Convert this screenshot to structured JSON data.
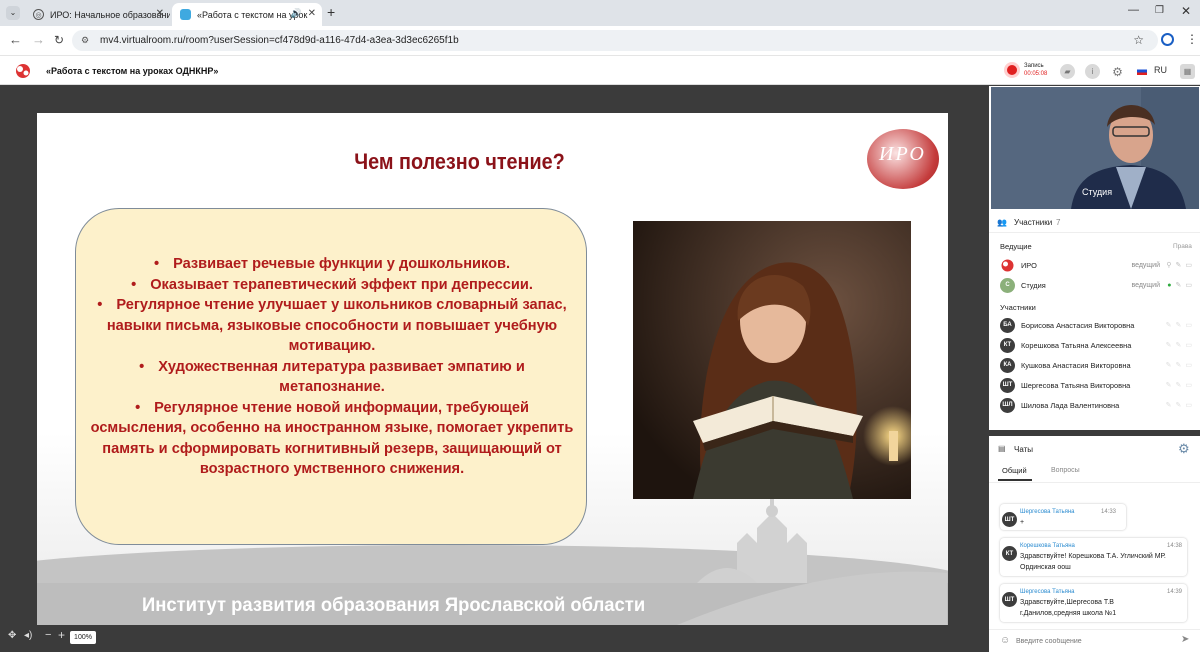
{
  "browser": {
    "tabs": [
      {
        "title": "ИРО: Начальное образование",
        "active": false
      },
      {
        "title": "«Работа с текстом на урок",
        "active": true
      }
    ],
    "url": "mv4.virtualroom.ru/room?userSession=cf478d9d-a116-47d4-a3ea-3d3ec6265f1b"
  },
  "app": {
    "room_title": "«Работа с текстом на уроках ОДНКНР»",
    "record": {
      "label": "Запись",
      "time": "00:05:08"
    },
    "language": "RU"
  },
  "slide": {
    "title": "Чем полезно чтение?",
    "logo_text": "ИРО",
    "bullets": [
      "Развивает речевые функции у дошкольников.",
      "Оказывает терапевтический эффект при депрессии.",
      "Регулярное чтение улучшает у школьников словарный запас, навыки письма, языковые способности и повышает учебную мотивацию.",
      "Художественная литература развивает эмпатию и метапознание.",
      "Регулярное чтение новой информации, требующей осмысления, особенно на иностранном языке, помогает укрепить память и сформировать когнитивный резерв, защищающий от возрастного умственного снижения."
    ],
    "footer": "Институт развития образования Ярославской области"
  },
  "zoom": "100%",
  "video": {
    "label": "Студия"
  },
  "participants": {
    "title": "Участники",
    "count": "7",
    "hosts_label": "Ведущие",
    "rights_label": "Права",
    "hosts": [
      {
        "name": "ИРО",
        "role": "ведущий",
        "avatar": "logo"
      },
      {
        "name": "Студия",
        "role": "ведущий",
        "avatar": "С"
      }
    ],
    "members_label": "Участники",
    "members": [
      {
        "initials": "БА",
        "name": "Борисова Анастасия Викторовна"
      },
      {
        "initials": "КТ",
        "name": "Корешкова Татьяна Алексеевна"
      },
      {
        "initials": "КА",
        "name": "Кушкова Анастасия Викторовна"
      },
      {
        "initials": "ШТ",
        "name": "Шергесова Татьяна Викторовна"
      },
      {
        "initials": "ШЛ",
        "name": "Шилова Лада Валентиновна"
      }
    ]
  },
  "chat": {
    "title": "Чаты",
    "tabs": [
      "Общий",
      "Вопросы"
    ],
    "messages": [
      {
        "initials": "ШТ",
        "author": "Шергесова Татьяна",
        "time": "14:33",
        "text": "+"
      },
      {
        "initials": "КТ",
        "author": "Корешкова Татьяна",
        "time": "14:38",
        "text": "Здравствуйте! Корешкова Т.А. Угличский МР. Ординская оош"
      },
      {
        "initials": "ШТ",
        "author": "Шергесова Татьяна",
        "time": "14:39",
        "text": "Здравствуйте,Шергесова Т.В г.Данилов,средняя школа №1"
      }
    ],
    "input_placeholder": "Введите сообщение"
  },
  "colors": {
    "accent": "#8b1219",
    "bullet_text": "#b01c1c",
    "bubble_bg": "#fdf1cb",
    "record_red": "#e02020",
    "link_blue": "#2a8bd0"
  }
}
